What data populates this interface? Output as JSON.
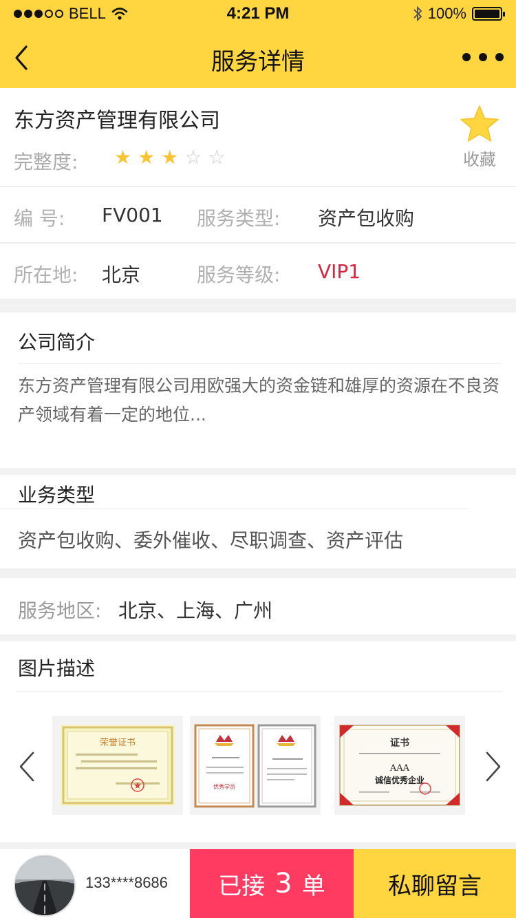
{
  "status_bar": {
    "carrier": "BELL",
    "time": "4:21 PM",
    "battery": "100%"
  },
  "nav": {
    "title": "服务详情"
  },
  "company": {
    "name": "东方资产管理有限公司",
    "rating_label": "完整度:",
    "rating": 3,
    "rating_max": 5,
    "favorite_label": "收藏",
    "colors": {
      "star": "#f7c533",
      "accent": "#ffd63f"
    }
  },
  "info": {
    "id_label": "编    号:",
    "id_value": "FV001",
    "type_label": "服务类型:",
    "type_value": "资产包收购",
    "location_label": "所在地:",
    "location_value": "北京",
    "level_label": "服务等级:",
    "level_value": "VIP1"
  },
  "intro": {
    "title": "公司简介",
    "text": "东方资产管理有限公司用欧强大的资金链和雄厚的资源在不良资产领域有着一定的地位..."
  },
  "business": {
    "title": "业务类型",
    "text": "资产包收购、委外催收、尽职调查、资产评估"
  },
  "region": {
    "label": "服务地区:",
    "value": "北京、上海、广州"
  },
  "gallery": {
    "title": "图片描述",
    "images": [
      {
        "title": "荣誉证书"
      },
      {
        "title": "优秀学员"
      },
      {
        "title": "证书",
        "subtitle": "AAA",
        "caption": "诚信优秀企业"
      }
    ]
  },
  "bottom": {
    "phone": "133****8686",
    "orders_prefix": "已接",
    "orders_count": "3",
    "orders_suffix": "单",
    "chat_label": "私聊留言",
    "colors": {
      "orders": "#ff3b61",
      "chat": "#ffd63f"
    }
  }
}
